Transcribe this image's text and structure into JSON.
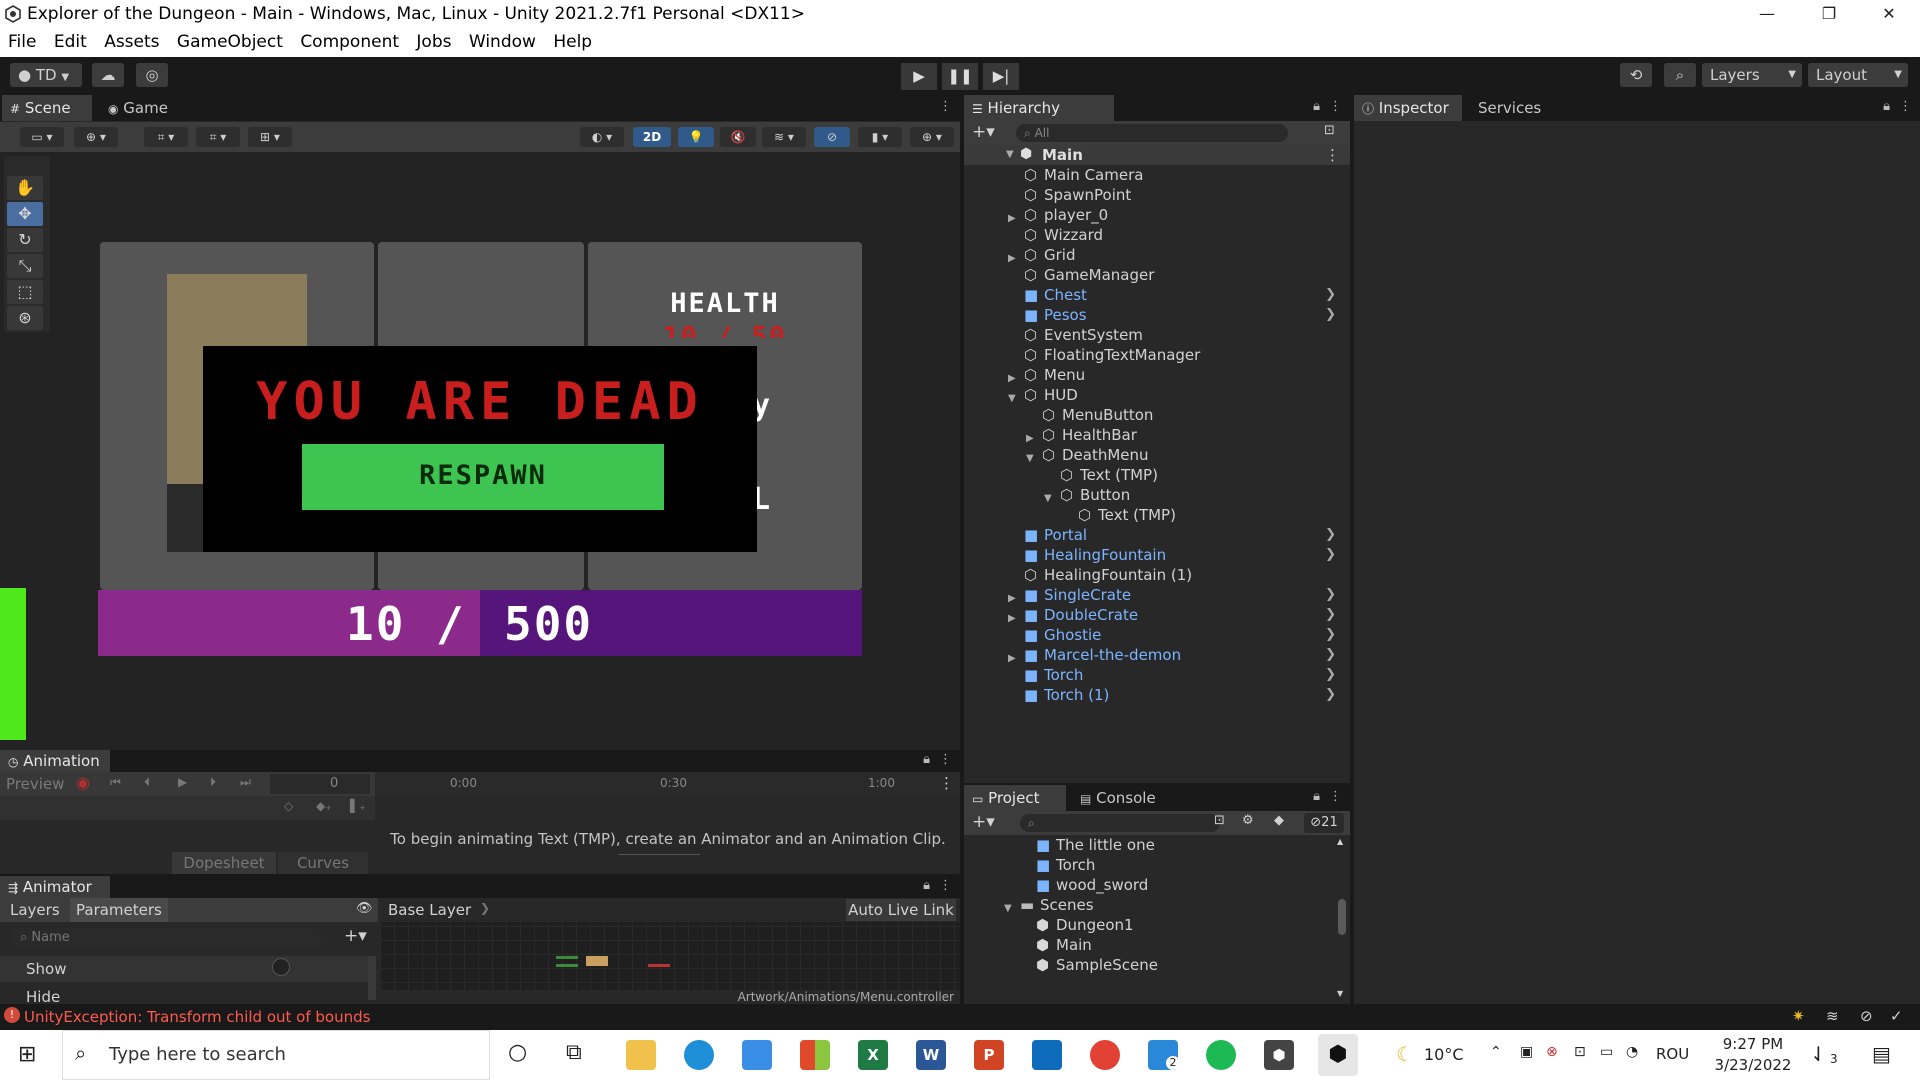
{
  "window": {
    "title": "Explorer of the Dungeon - Main - Windows, Mac, Linux - Unity 2021.2.7f1 Personal <DX11>",
    "controls": [
      "—",
      "❐",
      "✕"
    ]
  },
  "menubar": [
    "File",
    "Edit",
    "Assets",
    "GameObject",
    "Component",
    "Jobs",
    "Window",
    "Help"
  ],
  "toolbar": {
    "account": "TD",
    "layers": "Layers",
    "layout": "Layout"
  },
  "scene_panel": {
    "tabs": [
      "Scene",
      "Game"
    ],
    "mode_2d": "2D"
  },
  "game_view": {
    "health_label": "HEALTH",
    "health_value": "10 / 50",
    "death_title": "YOU ARE DEAD",
    "respawn_label": "RESPAWN",
    "xp_text_left": "10",
    "xp_text_sep": "/",
    "xp_text_right": "500",
    "hidden_y": "y",
    "hidden_l": "L"
  },
  "hierarchy": {
    "tab": "Hierarchy",
    "search_placeholder": "All",
    "scene_name": "Main",
    "items": [
      {
        "label": "Main Camera",
        "depth": 1,
        "prefab": false,
        "expand": "",
        "chev": false
      },
      {
        "label": "SpawnPoint",
        "depth": 1,
        "prefab": false,
        "expand": "",
        "chev": false
      },
      {
        "label": "player_0",
        "depth": 1,
        "prefab": false,
        "expand": "▶",
        "chev": false
      },
      {
        "label": "Wizzard",
        "depth": 1,
        "prefab": false,
        "expand": "",
        "chev": false
      },
      {
        "label": "Grid",
        "depth": 1,
        "prefab": false,
        "expand": "▶",
        "chev": false
      },
      {
        "label": "GameManager",
        "depth": 1,
        "prefab": false,
        "expand": "",
        "chev": false
      },
      {
        "label": "Chest",
        "depth": 1,
        "prefab": true,
        "expand": "",
        "chev": true
      },
      {
        "label": "Pesos",
        "depth": 1,
        "prefab": true,
        "expand": "",
        "chev": true
      },
      {
        "label": "EventSystem",
        "depth": 1,
        "prefab": false,
        "expand": "",
        "chev": false
      },
      {
        "label": "FloatingTextManager",
        "depth": 1,
        "prefab": false,
        "expand": "",
        "chev": false
      },
      {
        "label": "Menu",
        "depth": 1,
        "prefab": false,
        "expand": "▶",
        "chev": false
      },
      {
        "label": "HUD",
        "depth": 1,
        "prefab": false,
        "expand": "▼",
        "chev": false
      },
      {
        "label": "MenuButton",
        "depth": 2,
        "prefab": false,
        "expand": "",
        "chev": false
      },
      {
        "label": "HealthBar",
        "depth": 2,
        "prefab": false,
        "expand": "▶",
        "chev": false
      },
      {
        "label": "DeathMenu",
        "depth": 2,
        "prefab": false,
        "expand": "▼",
        "chev": false
      },
      {
        "label": "Text (TMP)",
        "depth": 3,
        "prefab": false,
        "expand": "",
        "chev": false
      },
      {
        "label": "Button",
        "depth": 3,
        "prefab": false,
        "expand": "▼",
        "chev": false
      },
      {
        "label": "Text (TMP)",
        "depth": 4,
        "prefab": false,
        "expand": "",
        "chev": false
      },
      {
        "label": "Portal",
        "depth": 1,
        "prefab": true,
        "expand": "",
        "chev": true
      },
      {
        "label": "HealingFountain",
        "depth": 1,
        "prefab": true,
        "expand": "",
        "chev": true
      },
      {
        "label": "HealingFountain (1)",
        "depth": 1,
        "prefab": false,
        "expand": "",
        "chev": false
      },
      {
        "label": "SingleCrate",
        "depth": 1,
        "prefab": true,
        "expand": "▶",
        "chev": true
      },
      {
        "label": "DoubleCrate",
        "depth": 1,
        "prefab": true,
        "expand": "▶",
        "chev": true
      },
      {
        "label": "Ghostie",
        "depth": 1,
        "prefab": true,
        "expand": "",
        "chev": true
      },
      {
        "label": "Marcel-the-demon",
        "depth": 1,
        "prefab": true,
        "expand": "▶",
        "chev": true
      },
      {
        "label": "Torch",
        "depth": 1,
        "prefab": true,
        "expand": "",
        "chev": true
      },
      {
        "label": "Torch (1)",
        "depth": 1,
        "prefab": true,
        "expand": "",
        "chev": true
      }
    ]
  },
  "inspector": {
    "tabs": [
      "Inspector",
      "Services"
    ]
  },
  "project": {
    "tabs": [
      "Project",
      "Console"
    ],
    "hidden_count": "21",
    "items": [
      {
        "label": "The little one",
        "type": "prefab",
        "depth": 1,
        "expand": ""
      },
      {
        "label": "Torch",
        "type": "prefab",
        "depth": 1,
        "expand": ""
      },
      {
        "label": "wood_sword",
        "type": "prefab",
        "depth": 1,
        "expand": ""
      },
      {
        "label": "Scenes",
        "type": "folder",
        "depth": 0,
        "expand": "▼"
      },
      {
        "label": "Dungeon1",
        "type": "scene",
        "depth": 1,
        "expand": ""
      },
      {
        "label": "Main",
        "type": "scene",
        "depth": 1,
        "expand": ""
      },
      {
        "label": "SampleScene",
        "type": "scene",
        "depth": 1,
        "expand": ""
      }
    ]
  },
  "animation": {
    "tab": "Animation",
    "preview": "Preview",
    "frame": "0",
    "timeline_marks": [
      "0:00",
      "0:30",
      "1:00"
    ],
    "message": "To begin animating Text (TMP), create an Animator and an Animation Clip.",
    "bottom_tabs": [
      "Dopesheet",
      "Curves"
    ]
  },
  "animator": {
    "tab": "Animator",
    "subtabs": [
      "Layers",
      "Parameters"
    ],
    "search_placeholder": "Name",
    "params": [
      "Show",
      "Hide"
    ],
    "base_layer": "Base Layer",
    "auto_live": "Auto Live Link",
    "path": "Artwork/Animations/Menu.controller"
  },
  "status": {
    "error": "UnityException: Transform child out of bounds"
  },
  "taskbar": {
    "search_placeholder": "Type here to search",
    "weather": "10°C",
    "lang": "ROU",
    "time": "9:27 PM",
    "date": "3/23/2022",
    "notif": "3",
    "badge_2": "2"
  },
  "colors": {
    "accent_blue": "#7cb4ff",
    "death_red": "#c81e1e",
    "respawn_green": "#3ec450",
    "xp_purple": "#8b2a8b",
    "xp_dark_purple": "#56157a",
    "error_red": "#ff5a50"
  }
}
